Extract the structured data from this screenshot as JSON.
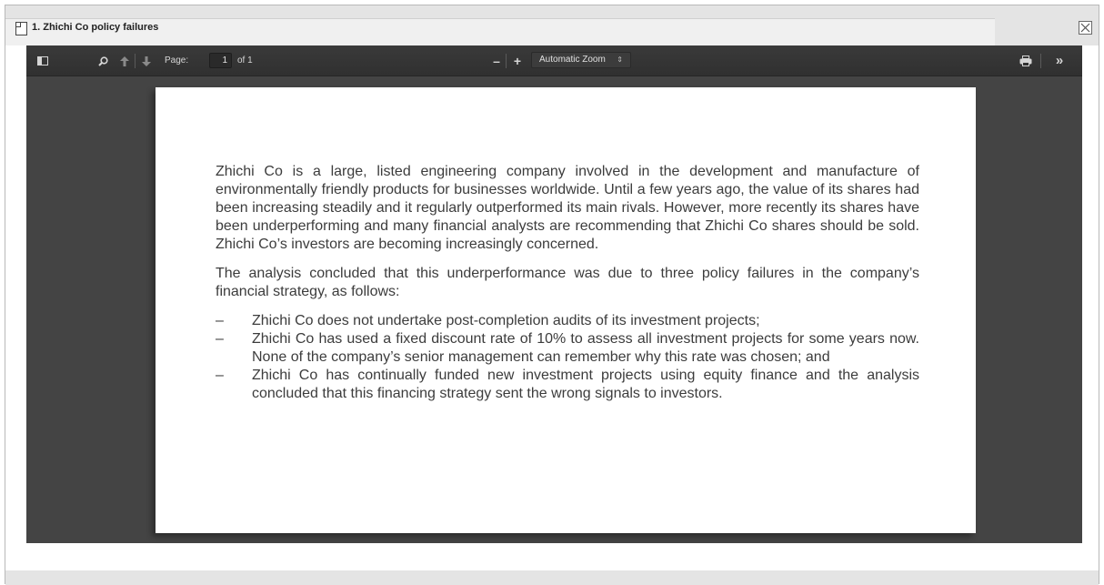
{
  "window": {
    "title": "1. Zhichi Co policy failures"
  },
  "toolbar": {
    "page_label": "Page:",
    "page_number": "1",
    "page_total": "of 1",
    "zoom_out_label": "–",
    "zoom_in_label": "+",
    "zoom_selected": "Automatic Zoom",
    "more_label": "»"
  },
  "document": {
    "paragraphs": [
      "Zhichi Co is a large, listed engineering company involved in the development and manufacture of environmentally friendly products for businesses worldwide. Until a few years ago, the value of its shares had been increasing steadily and it regularly outperformed its main rivals. However, more recently its shares have been underperforming and many financial analysts are recommending that Zhichi Co shares should be sold. Zhichi Co’s investors are becoming increasingly concerned.",
      "The analysis concluded that this underperformance was due to three policy failures in the company’s financial strategy, as follows:"
    ],
    "bullet_marker": "–",
    "bullets": [
      "Zhichi Co does not undertake post-completion audits of its investment projects;",
      "Zhichi Co has used a fixed discount rate of 10% to assess all investment projects for some years now. None of the company’s senior management can remember why this rate was chosen; and",
      "Zhichi Co has continually funded new investment projects using equity finance and the analysis concluded that this financing strategy sent the wrong signals to investors."
    ]
  },
  "icons": {
    "title": "document-icon",
    "close": "close-icon",
    "sidebar": "sidebar-toggle-icon",
    "search": "search-icon",
    "prev": "arrow-up-icon",
    "next": "arrow-down-icon",
    "print": "print-icon"
  }
}
